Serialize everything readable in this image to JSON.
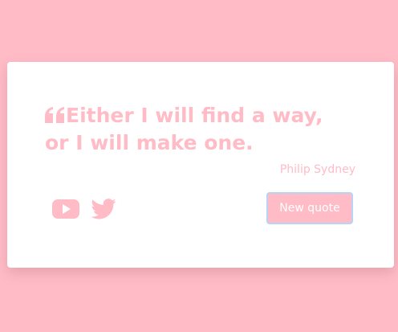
{
  "quote": {
    "text": "Either I will find a way, or I will make one.",
    "icon": "quote-left-icon"
  },
  "author": "Philip Sydney",
  "socials": [
    {
      "name": "youtube-icon"
    },
    {
      "name": "twitter-icon"
    }
  ],
  "button": {
    "label": "New quote"
  },
  "colors": {
    "background": "#ffbcc7",
    "card": "#ffffff",
    "accent": "#ffbcc7",
    "button_border": "#b9d3f5"
  }
}
